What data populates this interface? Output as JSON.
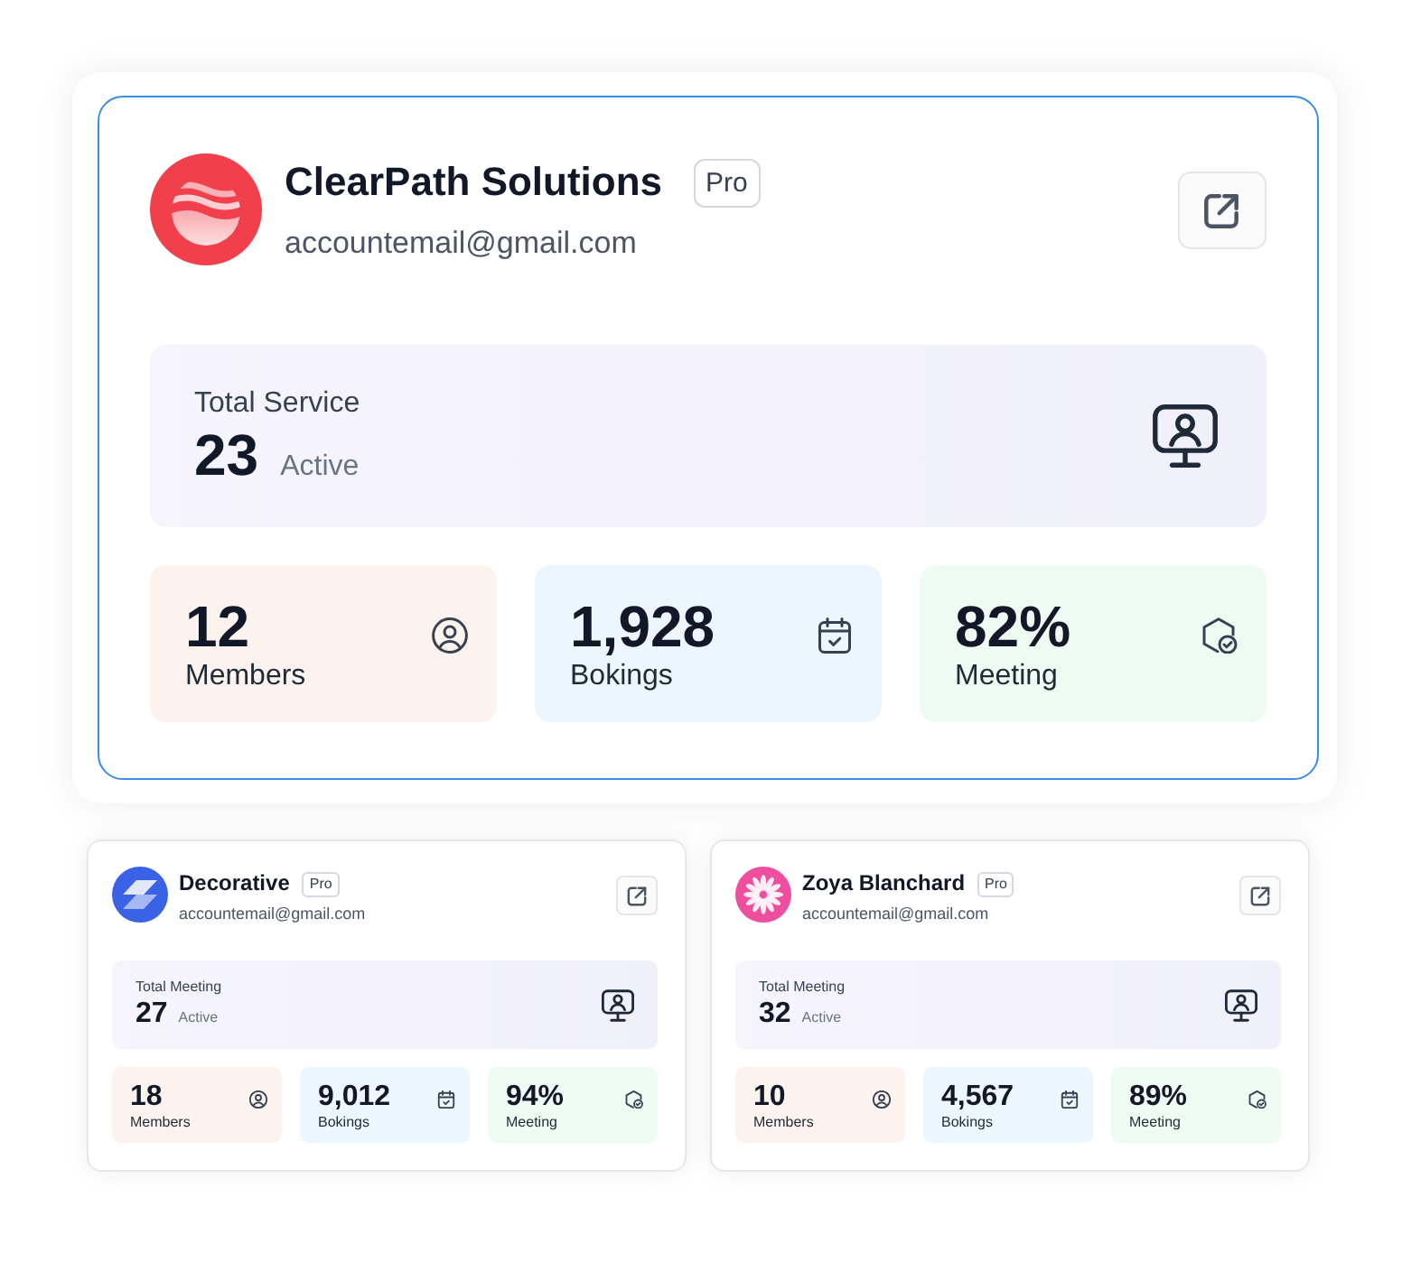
{
  "cards": [
    {
      "kind": "featured",
      "selected": true,
      "avatar": {
        "kind": "waves",
        "color": "#f1404c"
      },
      "name": "ClearPath Solutions",
      "badge": "Pro",
      "email": "accountemail@gmail.com",
      "summary": {
        "label": "Total Service",
        "value": "23",
        "status": "Active"
      },
      "stats": [
        {
          "kind": "members",
          "value": "12",
          "label": "Members"
        },
        {
          "kind": "bookings",
          "value": "1,928",
          "label": "Bokings"
        },
        {
          "kind": "meeting",
          "value": "82%",
          "label": "Meeting"
        }
      ]
    },
    {
      "kind": "compact",
      "selected": false,
      "avatar": {
        "kind": "layers",
        "color": "#3a62e6"
      },
      "name": "Decorative",
      "badge": "Pro",
      "email": "accountemail@gmail.com",
      "summary": {
        "label": "Total Meeting",
        "value": "27",
        "status": "Active"
      },
      "stats": [
        {
          "kind": "members",
          "value": "18",
          "label": "Members"
        },
        {
          "kind": "bookings",
          "value": "9,012",
          "label": "Bokings"
        },
        {
          "kind": "meeting",
          "value": "94%",
          "label": "Meeting"
        }
      ]
    },
    {
      "kind": "compact",
      "selected": false,
      "avatar": {
        "kind": "flower",
        "color": "#ee4e9d"
      },
      "name": "Zoya Blanchard",
      "badge": "Pro",
      "email": "accountemail@gmail.com",
      "summary": {
        "label": "Total Meeting",
        "value": "32",
        "status": "Active"
      },
      "stats": [
        {
          "kind": "members",
          "value": "10",
          "label": "Members"
        },
        {
          "kind": "bookings",
          "value": "4,567",
          "label": "Bokings"
        },
        {
          "kind": "meeting",
          "value": "89%",
          "label": "Meeting"
        }
      ]
    }
  ]
}
